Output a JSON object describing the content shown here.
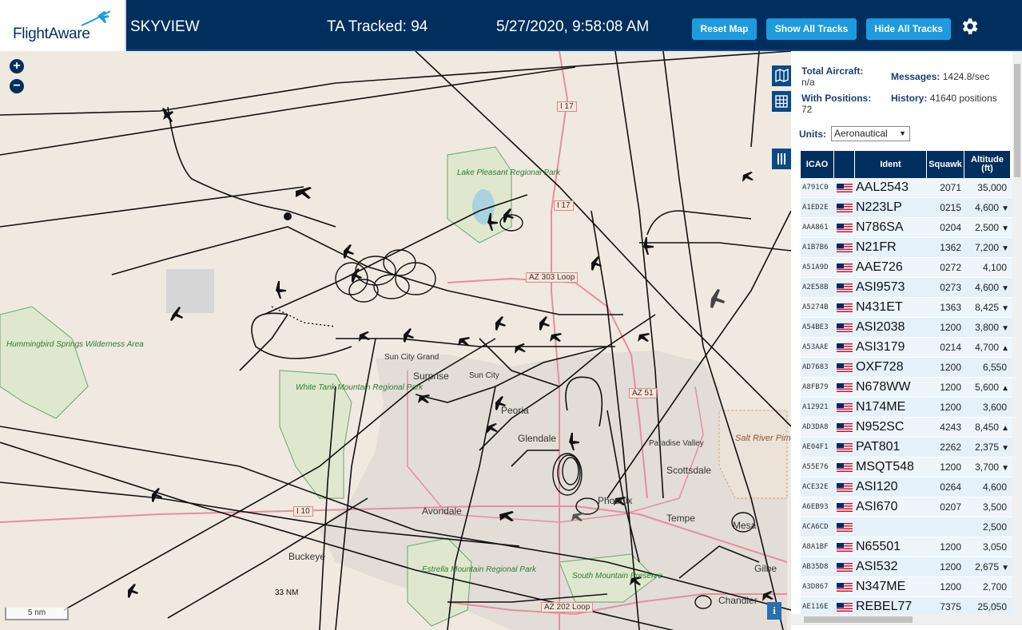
{
  "header": {
    "logo_text": "FlightAware",
    "app_title": "SKYVIEW",
    "tracked": "TA Tracked: 94",
    "datetime": "5/27/2020, 9:58:08 AM",
    "buttons": {
      "reset": "Reset Map",
      "show": "Show All Tracks",
      "hide": "Hide All Tracks"
    },
    "accent_color": "#1e9bde",
    "bar_color": "#002f5d"
  },
  "map": {
    "labels": {
      "surprise": "Surprise",
      "sun_city": "Sun City",
      "sun_city_grand": "Sun City Grand",
      "glendale": "Glendale",
      "peoria": "Peoria",
      "avondale": "Avondale",
      "buckeye": "Buckeye",
      "paradise_valley": "Paradise Valley",
      "scottsdale": "Scottsdale",
      "tempe": "Tempe",
      "mesa": "Mesa",
      "gilbert": "Gilbe",
      "chandler": "Chandler",
      "phoenix": "Phoenix"
    },
    "parks": {
      "hummingbird": "Hummingbird Springs Wilderness Area",
      "white_tank": "White Tank Mountain Regional Park",
      "lake_pleasant": "Lake Pleasant Regional Park",
      "estrella": "Estrella Mountain Regional Park",
      "south_mountain": "South Mountain Preserve"
    },
    "reservation": "Salt River Pima - Maricopa Indian Community",
    "highways": {
      "i17a": "I 17",
      "i17b": "I 17",
      "az303": "AZ 303 Loop",
      "az51": "AZ 51",
      "i10": "I 10",
      "az202": "AZ 202 Loop"
    },
    "range_ring": "33 NM",
    "scale": "5 nm",
    "info": "i"
  },
  "sidebar": {
    "total_aircraft_label": "Total Aircraft:",
    "total_aircraft_value": "n/a",
    "with_positions_label": "With Positions:",
    "with_positions_value": "72",
    "messages_label": "Messages:",
    "messages_value": "1424.8/sec",
    "history_label": "History:",
    "history_value": "41640 positions",
    "units_label": "Units:",
    "units_value": "Aeronautical",
    "columns": {
      "icao": "ICAO",
      "ident": "Ident",
      "squawk": "Squawk",
      "altitude": "Altitude (ft)"
    },
    "rows": [
      {
        "icao": "A791C0",
        "ident": "AAL2543",
        "squawk": "2071",
        "alt": "35,000",
        "trend": ""
      },
      {
        "icao": "A1ED2E",
        "ident": "N223LP",
        "squawk": "0215",
        "alt": "4,600",
        "trend": "▼"
      },
      {
        "icao": "AAA861",
        "ident": "N786SA",
        "squawk": "0204",
        "alt": "2,500",
        "trend": "▼"
      },
      {
        "icao": "A1B7B6",
        "ident": "N21FR",
        "squawk": "1362",
        "alt": "7,200",
        "trend": "▼"
      },
      {
        "icao": "A51A9D",
        "ident": "AAE726",
        "squawk": "0272",
        "alt": "4,100",
        "trend": ""
      },
      {
        "icao": "A2E58B",
        "ident": "ASI9573",
        "squawk": "0273",
        "alt": "4,600",
        "trend": "▼"
      },
      {
        "icao": "A5274B",
        "ident": "N431ET",
        "squawk": "1363",
        "alt": "8,425",
        "trend": "▼"
      },
      {
        "icao": "A54BE3",
        "ident": "ASI2038",
        "squawk": "1200",
        "alt": "3,800",
        "trend": "▼"
      },
      {
        "icao": "A53AAE",
        "ident": "ASI3179",
        "squawk": "0214",
        "alt": "4,700",
        "trend": "▲"
      },
      {
        "icao": "AD7683",
        "ident": "OXF728",
        "squawk": "1200",
        "alt": "6,550",
        "trend": ""
      },
      {
        "icao": "A8FB79",
        "ident": "N678WW",
        "squawk": "1200",
        "alt": "5,600",
        "trend": "▲"
      },
      {
        "icao": "A12921",
        "ident": "N174ME",
        "squawk": "1200",
        "alt": "3,600",
        "trend": ""
      },
      {
        "icao": "AD3DA8",
        "ident": "N952SC",
        "squawk": "4243",
        "alt": "8,450",
        "trend": "▲"
      },
      {
        "icao": "AE04F1",
        "ident": "PAT801",
        "squawk": "2262",
        "alt": "2,375",
        "trend": "▼"
      },
      {
        "icao": "A55E76",
        "ident": "MSQT548",
        "squawk": "1200",
        "alt": "3,700",
        "trend": "▼"
      },
      {
        "icao": "ACE32E",
        "ident": "ASI120",
        "squawk": "0264",
        "alt": "4,600",
        "trend": ""
      },
      {
        "icao": "A6EB93",
        "ident": "ASI670",
        "squawk": "0207",
        "alt": "3,500",
        "trend": ""
      },
      {
        "icao": "ACA6CD",
        "ident": "",
        "squawk": "",
        "alt": "2,500",
        "trend": ""
      },
      {
        "icao": "A8A1BF",
        "ident": "N65501",
        "squawk": "1200",
        "alt": "3,050",
        "trend": ""
      },
      {
        "icao": "AB35D8",
        "ident": "ASI532",
        "squawk": "1200",
        "alt": "2,675",
        "trend": "▼"
      },
      {
        "icao": "A3D867",
        "ident": "N347ME",
        "squawk": "1200",
        "alt": "2,700",
        "trend": ""
      },
      {
        "icao": "AE116E",
        "ident": "REBEL77",
        "squawk": "7375",
        "alt": "25,050",
        "trend": ""
      }
    ]
  }
}
